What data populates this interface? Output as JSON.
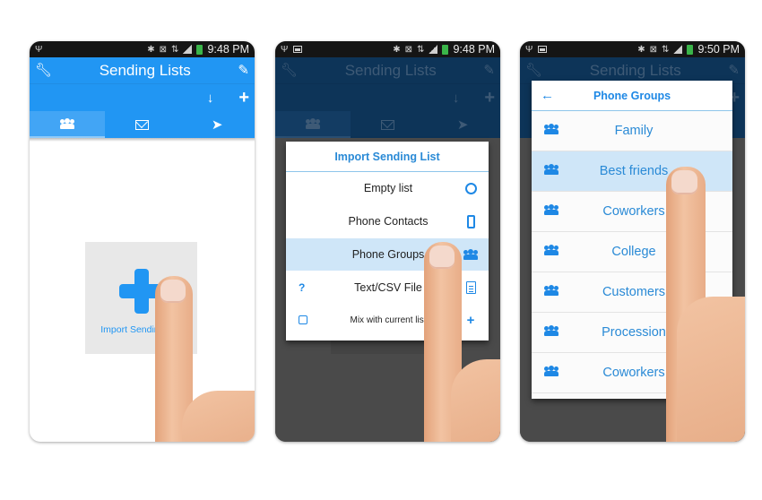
{
  "screens": [
    {
      "status": {
        "time": "9:48 PM"
      },
      "appbar": {
        "title": "Sending Lists",
        "icons": [
          "wrench-icon",
          "brush-icon",
          "download-icon",
          "add-icon"
        ],
        "tabs": [
          "people-icon",
          "envelope-icon",
          "send-icon"
        ],
        "active_tab": 0
      },
      "body": {
        "import_label": "Import Sending List"
      }
    },
    {
      "status": {
        "time": "9:48 PM"
      },
      "appbar": {
        "title": "Sending Lists"
      },
      "dialog": {
        "title": "Import Sending List",
        "items": [
          {
            "label": "Empty list",
            "icon": "circle-icon"
          },
          {
            "label": "Phone Contacts",
            "icon": "phone-icon"
          },
          {
            "label": "Phone Groups",
            "icon": "people-icon",
            "selected": true
          },
          {
            "label": "Text/CSV File",
            "icon": "document-icon",
            "lead": "?"
          },
          {
            "label": "Mix with current list",
            "icon": "plus-icon",
            "lead": "checkbox"
          }
        ]
      }
    },
    {
      "status": {
        "time": "9:50 PM"
      },
      "appbar": {
        "title": "Sending Lists"
      },
      "groups": {
        "title": "Phone Groups",
        "items": [
          {
            "label": "Family"
          },
          {
            "label": "Best friends",
            "selected": true
          },
          {
            "label": "Coworkers"
          },
          {
            "label": "College"
          },
          {
            "label": "Customers"
          },
          {
            "label": "Procession"
          },
          {
            "label": "Coworkers"
          }
        ]
      }
    }
  ],
  "colors": {
    "accent": "#2196f3",
    "dim_header": "#0d3458",
    "selected_row": "#cfe6f8",
    "overlay": "#4a4a4a"
  }
}
